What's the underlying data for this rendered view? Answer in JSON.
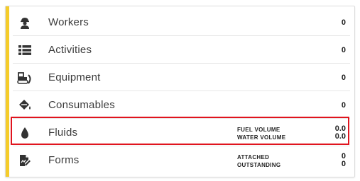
{
  "rows": [
    {
      "label": "Workers",
      "icon": "worker-icon",
      "count": "0"
    },
    {
      "label": "Activities",
      "icon": "list-icon",
      "count": "0"
    },
    {
      "label": "Equipment",
      "icon": "bulldozer-icon",
      "count": "0"
    },
    {
      "label": "Consumables",
      "icon": "paint-bucket-icon",
      "count": "0"
    }
  ],
  "fluids": {
    "label": "Fluids",
    "icon": "droplet-icon",
    "fuel_label": "FUEL VOLUME",
    "water_label": "WATER VOLUME",
    "fuel_value": "0.0",
    "water_value": "0.0"
  },
  "forms": {
    "label": "Forms",
    "icon": "form-edit-icon",
    "attached_label": "ATTACHED",
    "outstanding_label": "OUTSTANDING",
    "attached_value": "0",
    "outstanding_value": "0"
  },
  "colors": {
    "accent": "#f5cc2a",
    "highlight": "#e0141e",
    "icon": "#333333"
  }
}
